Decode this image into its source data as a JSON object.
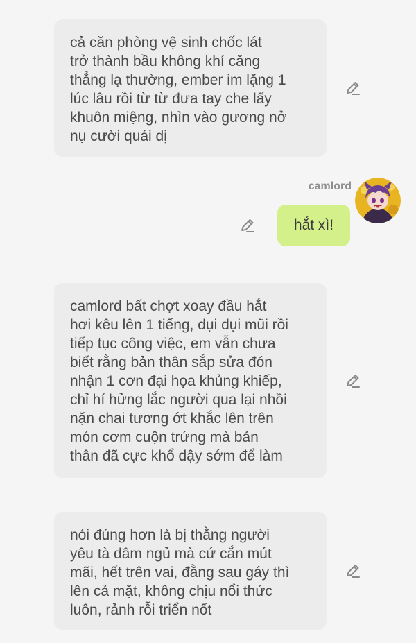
{
  "messages": [
    {
      "side": "left",
      "text": "cả căn phòng vệ sinh chốc lát\ntrở thành bầu không khí căng\nthẳng lạ thường, ember im lặng 1\nlúc lâu rồi từ từ đưa tay  che lấy\nkhuôn miệng, nhìn vào gương nở\nnụ cười quái dị",
      "icon": "pencil-icon"
    },
    {
      "side": "right",
      "author": "camlord",
      "text": "hắt xì!",
      "icon": "pencil-icon"
    },
    {
      "side": "left",
      "text": "camlord bất chợt xoay đầu hắt\nhơi kêu lên 1 tiếng, dụi dụi mũi rồi\ntiếp tục công việc, em vẫn chưa\nbiết rằng bản thân sắp sửa đón\nnhận 1 cơn đại họa khủng khiếp,\nchỉ hí hửng lắc người qua lại nhồi\nnặn chai tương ớt khắc lên trên\nmón cơm cuộn trứng mà bản\nthân đã cực khổ dậy sớm để làm",
      "icon": "pencil-icon"
    },
    {
      "side": "left",
      "text": "nói đúng hơn là bị thằng người\nyêu tà dâm ngủ mà cứ cắn mút\nmãi, hết trên vai, đằng sau gáy thì\nlên cả mặt, không chịu nổi thức\nluôn, rảnh rỗi triển nốt",
      "icon": "pencil-icon"
    }
  ],
  "colors": {
    "background": "#f5f5f5",
    "left_bubble": "#ececec",
    "right_bubble": "#d4f08a",
    "icon": "#8a8a8a"
  }
}
